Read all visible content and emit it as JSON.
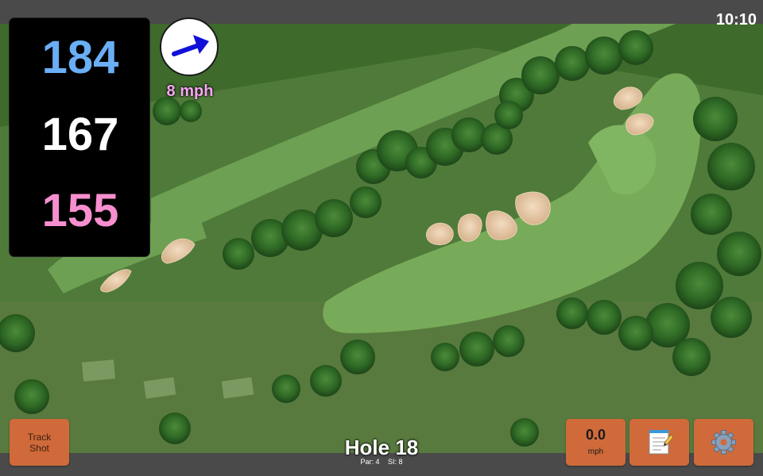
{
  "status_bar": {
    "time": "10:10"
  },
  "yardages": {
    "back": "184",
    "middle": "167",
    "front": "155"
  },
  "wind": {
    "speed_label": "8 mph",
    "direction_icon": "arrow-right-icon"
  },
  "hole": {
    "title": "Hole 18",
    "par": "Par: 4",
    "si": "SI: 8"
  },
  "buttons": {
    "track_shot_line1": "Track",
    "track_shot_line2": "Shot",
    "speed_value": "0.0",
    "speed_unit": "mph",
    "notes_icon": "notepad-icon",
    "settings_icon": "gear-icon"
  },
  "colors": {
    "back": "#6aaef5",
    "middle": "#ffffff",
    "front": "#f78fcf",
    "button": "#d06a3a",
    "wind_text": "#f7a6f0"
  }
}
